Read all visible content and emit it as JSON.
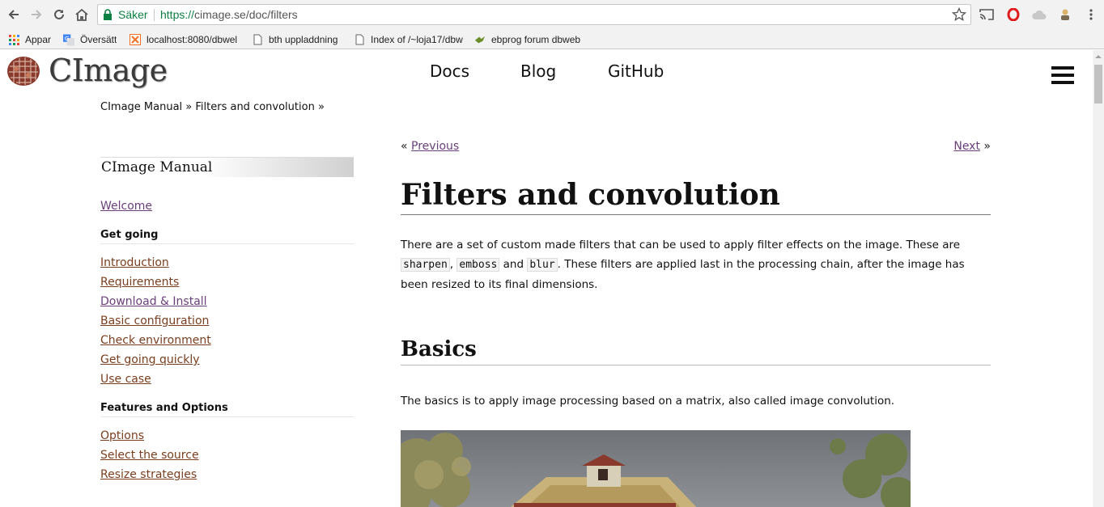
{
  "browser": {
    "security_label": "Säker",
    "url_scheme": "https://",
    "url_rest": "cimage.se/doc/filters",
    "bookmarks": [
      {
        "label": "Appar",
        "icon": "apps-grid-icon"
      },
      {
        "label": "Översätt",
        "icon": "translate-icon"
      },
      {
        "label": "localhost:8080/dbwel",
        "icon": "xampp-icon"
      },
      {
        "label": "bth uppladdning",
        "icon": "page-icon"
      },
      {
        "label": "Index of /~loja17/dbw",
        "icon": "page-icon"
      },
      {
        "label": "ebprog forum dbweb",
        "icon": "bird-icon"
      }
    ]
  },
  "site": {
    "logo_text": "CImage",
    "nav": [
      {
        "label": "Docs"
      },
      {
        "label": "Blog"
      },
      {
        "label": "GitHub"
      }
    ]
  },
  "breadcrumb": "CImage Manual » Filters and convolution »",
  "sidebar": {
    "title": "CImage Manual",
    "welcome": "Welcome",
    "section1": {
      "heading": "Get going",
      "links": [
        "Introduction",
        "Requirements",
        "Download & Install",
        "Basic configuration",
        "Check environment",
        "Get going quickly",
        "Use case"
      ]
    },
    "section2": {
      "heading": "Features and Options",
      "links": [
        "Options",
        "Select the source",
        "Resize strategies"
      ]
    }
  },
  "content": {
    "prev_prefix": "«",
    "prev": "Previous",
    "next": "Next",
    "next_suffix": "»",
    "title": "Filters and convolution",
    "intro": {
      "t1": "There are a set of custom made filters that can be used to apply filter effects on the image. These are ",
      "c1": "sharpen",
      "t2": ",",
      "c2": "emboss",
      "t3": " and ",
      "c3": "blur",
      "t4": ". These filters are applied last in the processing chain, after the image has been resized to its final dimensions."
    },
    "basics_heading": "Basics",
    "basics_text": "The basics is to apply image processing based on a matrix, also called image convolution."
  },
  "colors": {
    "link": "#7a3e1e",
    "visited_link": "#6b3f7a",
    "secure_green": "#0b8043"
  }
}
